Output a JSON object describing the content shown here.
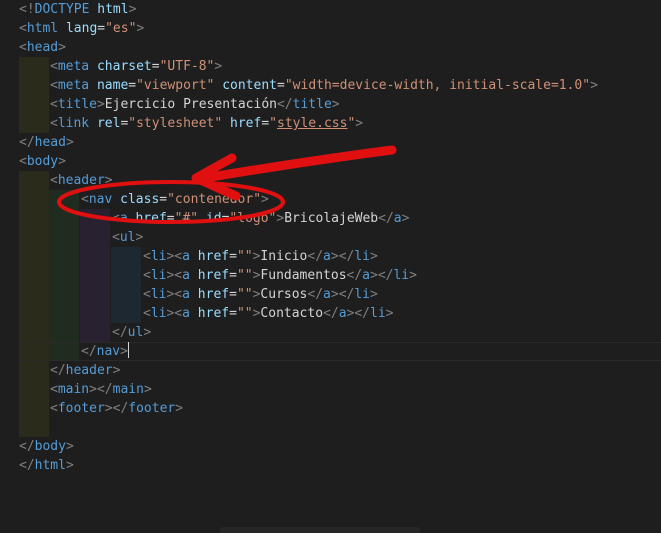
{
  "editor": {
    "language": "html",
    "accent_colors": {
      "tag": "#569cd6",
      "attribute": "#9cdcfe",
      "string": "#ce9178",
      "punctuation": "#808080",
      "text": "#d4d4d4",
      "annotation": "#e01010"
    },
    "lines": [
      {
        "indent": 0,
        "tokens": [
          [
            "p",
            "<!"
          ],
          [
            "t",
            "DOCTYPE"
          ],
          [
            "x",
            " "
          ],
          [
            "a",
            "html"
          ],
          [
            "p",
            ">"
          ]
        ]
      },
      {
        "indent": 0,
        "tokens": [
          [
            "p",
            "<"
          ],
          [
            "t",
            "html"
          ],
          [
            "x",
            " "
          ],
          [
            "a",
            "lang"
          ],
          [
            "x",
            "="
          ],
          [
            "s",
            "\"es\""
          ],
          [
            "p",
            ">"
          ]
        ]
      },
      {
        "indent": 0,
        "tokens": [
          [
            "p",
            "<"
          ],
          [
            "t",
            "head"
          ],
          [
            "p",
            ">"
          ]
        ]
      },
      {
        "indent": 1,
        "tokens": [
          [
            "p",
            "<"
          ],
          [
            "t",
            "meta"
          ],
          [
            "x",
            " "
          ],
          [
            "a",
            "charset"
          ],
          [
            "x",
            "="
          ],
          [
            "s",
            "\"UTF-8\""
          ],
          [
            "p",
            ">"
          ]
        ]
      },
      {
        "indent": 1,
        "tokens": [
          [
            "p",
            "<"
          ],
          [
            "t",
            "meta"
          ],
          [
            "x",
            " "
          ],
          [
            "a",
            "name"
          ],
          [
            "x",
            "="
          ],
          [
            "s",
            "\"viewport\""
          ],
          [
            "x",
            " "
          ],
          [
            "a",
            "content"
          ],
          [
            "x",
            "="
          ],
          [
            "s",
            "\"width=device-width, initial-scale=1.0\""
          ],
          [
            "p",
            ">"
          ]
        ]
      },
      {
        "indent": 1,
        "tokens": [
          [
            "p",
            "<"
          ],
          [
            "t",
            "title"
          ],
          [
            "p",
            ">"
          ],
          [
            "x",
            "Ejercicio Presentación"
          ],
          [
            "p",
            "</"
          ],
          [
            "t",
            "title"
          ],
          [
            "p",
            ">"
          ]
        ]
      },
      {
        "indent": 1,
        "tokens": [
          [
            "p",
            "<"
          ],
          [
            "t",
            "link"
          ],
          [
            "x",
            " "
          ],
          [
            "a",
            "rel"
          ],
          [
            "x",
            "="
          ],
          [
            "s",
            "\"stylesheet\""
          ],
          [
            "x",
            " "
          ],
          [
            "a",
            "href"
          ],
          [
            "x",
            "="
          ],
          [
            "s",
            "\""
          ],
          [
            "su",
            "style.css"
          ],
          [
            "s",
            "\""
          ],
          [
            "p",
            ">"
          ]
        ]
      },
      {
        "indent": 0,
        "tokens": [
          [
            "p",
            "</"
          ],
          [
            "t",
            "head"
          ],
          [
            "p",
            ">"
          ]
        ]
      },
      {
        "indent": 0,
        "tokens": [
          [
            "p",
            "<"
          ],
          [
            "t",
            "body"
          ],
          [
            "p",
            ">"
          ]
        ]
      },
      {
        "indent": 1,
        "tokens": [
          [
            "p",
            "<"
          ],
          [
            "t",
            "header"
          ],
          [
            "p",
            ">"
          ]
        ]
      },
      {
        "indent": 2,
        "tokens": [
          [
            "p",
            "<"
          ],
          [
            "t",
            "nav"
          ],
          [
            "x",
            " "
          ],
          [
            "a",
            "class"
          ],
          [
            "x",
            "="
          ],
          [
            "s",
            "\"contenedor\""
          ],
          [
            "p",
            ">"
          ]
        ]
      },
      {
        "indent": 3,
        "tokens": [
          [
            "p",
            "<"
          ],
          [
            "t",
            "a"
          ],
          [
            "x",
            " "
          ],
          [
            "a",
            "href"
          ],
          [
            "x",
            "="
          ],
          [
            "s",
            "\"#\""
          ],
          [
            "x",
            " "
          ],
          [
            "a",
            "id"
          ],
          [
            "x",
            "="
          ],
          [
            "s",
            "\"logo\""
          ],
          [
            "p",
            ">"
          ],
          [
            "x",
            "BricolajeWeb"
          ],
          [
            "p",
            "</"
          ],
          [
            "t",
            "a"
          ],
          [
            "p",
            ">"
          ]
        ]
      },
      {
        "indent": 3,
        "tokens": [
          [
            "p",
            "<"
          ],
          [
            "t",
            "ul"
          ],
          [
            "p",
            ">"
          ]
        ]
      },
      {
        "indent": 4,
        "tokens": [
          [
            "p",
            "<"
          ],
          [
            "t",
            "li"
          ],
          [
            "p",
            "><"
          ],
          [
            "t",
            "a"
          ],
          [
            "x",
            " "
          ],
          [
            "a",
            "href"
          ],
          [
            "x",
            "="
          ],
          [
            "s",
            "\"\""
          ],
          [
            "p",
            ">"
          ],
          [
            "x",
            "Inicio"
          ],
          [
            "p",
            "</"
          ],
          [
            "t",
            "a"
          ],
          [
            "p",
            "></"
          ],
          [
            "t",
            "li"
          ],
          [
            "p",
            ">"
          ]
        ]
      },
      {
        "indent": 4,
        "tokens": [
          [
            "p",
            "<"
          ],
          [
            "t",
            "li"
          ],
          [
            "p",
            "><"
          ],
          [
            "t",
            "a"
          ],
          [
            "x",
            " "
          ],
          [
            "a",
            "href"
          ],
          [
            "x",
            "="
          ],
          [
            "s",
            "\"\""
          ],
          [
            "p",
            ">"
          ],
          [
            "x",
            "Fundamentos"
          ],
          [
            "p",
            "</"
          ],
          [
            "t",
            "a"
          ],
          [
            "p",
            "></"
          ],
          [
            "t",
            "li"
          ],
          [
            "p",
            ">"
          ]
        ]
      },
      {
        "indent": 4,
        "tokens": [
          [
            "p",
            "<"
          ],
          [
            "t",
            "li"
          ],
          [
            "p",
            "><"
          ],
          [
            "t",
            "a"
          ],
          [
            "x",
            " "
          ],
          [
            "a",
            "href"
          ],
          [
            "x",
            "="
          ],
          [
            "s",
            "\"\""
          ],
          [
            "p",
            ">"
          ],
          [
            "x",
            "Cursos"
          ],
          [
            "p",
            "</"
          ],
          [
            "t",
            "a"
          ],
          [
            "p",
            "></"
          ],
          [
            "t",
            "li"
          ],
          [
            "p",
            ">"
          ]
        ]
      },
      {
        "indent": 4,
        "tokens": [
          [
            "p",
            "<"
          ],
          [
            "t",
            "li"
          ],
          [
            "p",
            "><"
          ],
          [
            "t",
            "a"
          ],
          [
            "x",
            " "
          ],
          [
            "a",
            "href"
          ],
          [
            "x",
            "="
          ],
          [
            "s",
            "\"\""
          ],
          [
            "p",
            ">"
          ],
          [
            "x",
            "Contacto"
          ],
          [
            "p",
            "</"
          ],
          [
            "t",
            "a"
          ],
          [
            "p",
            "></"
          ],
          [
            "t",
            "li"
          ],
          [
            "p",
            ">"
          ]
        ]
      },
      {
        "indent": 3,
        "tokens": [
          [
            "p",
            "</"
          ],
          [
            "t",
            "ul"
          ],
          [
            "p",
            ">"
          ]
        ]
      },
      {
        "indent": 2,
        "tokens": [
          [
            "p",
            "</"
          ],
          [
            "t",
            "nav"
          ],
          [
            "p",
            ">"
          ]
        ],
        "cursor": true
      },
      {
        "indent": 1,
        "tokens": [
          [
            "p",
            "</"
          ],
          [
            "t",
            "header"
          ],
          [
            "p",
            ">"
          ]
        ]
      },
      {
        "indent": 1,
        "tokens": [
          [
            "p",
            "<"
          ],
          [
            "t",
            "main"
          ],
          [
            "p",
            "></"
          ],
          [
            "t",
            "main"
          ],
          [
            "p",
            ">"
          ]
        ]
      },
      {
        "indent": 1,
        "tokens": [
          [
            "p",
            "<"
          ],
          [
            "t",
            "footer"
          ],
          [
            "p",
            "></"
          ],
          [
            "t",
            "footer"
          ],
          [
            "p",
            ">"
          ]
        ]
      },
      {
        "indent": 1,
        "tokens": []
      },
      {
        "indent": 0,
        "tokens": [
          [
            "p",
            "</"
          ],
          [
            "t",
            "body"
          ],
          [
            "p",
            ">"
          ]
        ]
      },
      {
        "indent": 0,
        "tokens": [
          [
            "p",
            "</"
          ],
          [
            "t",
            "html"
          ],
          [
            "p",
            ">"
          ]
        ]
      }
    ]
  }
}
